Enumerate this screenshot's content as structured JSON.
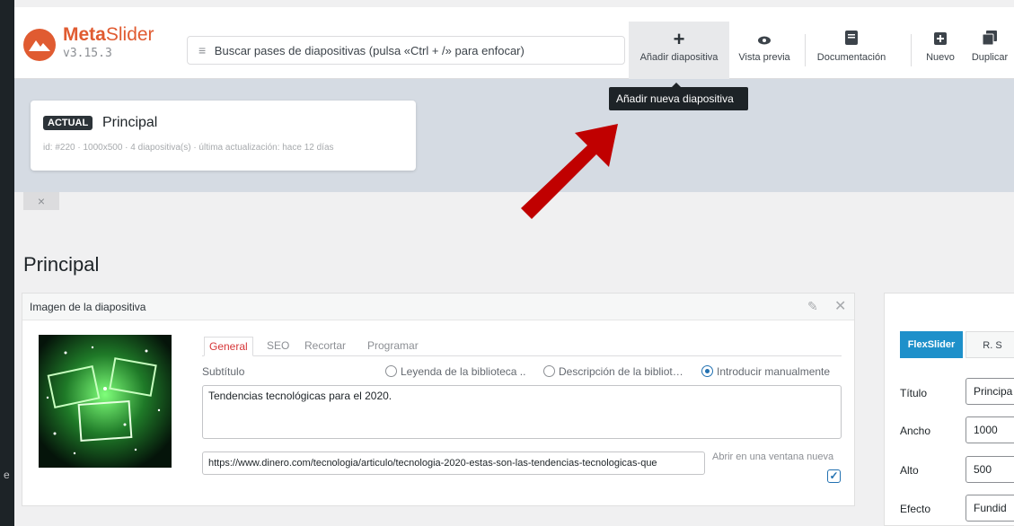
{
  "app": {
    "brand_meta": "Meta",
    "brand_slider": "Slider",
    "version": "v3.15.3",
    "accent": "#e05b31"
  },
  "search": {
    "icon": "hamburger-icon",
    "placeholder": "Buscar pases de diapositivas (pulsa «Ctrl + /» para enfocar)"
  },
  "toolbar": {
    "add_slide": "Añadir diapositiva",
    "preview": "Vista previa",
    "docs": "Documentación",
    "new": "Nuevo",
    "duplicate": "Duplicar"
  },
  "tooltip": "Añadir nueva diapositiva",
  "current_card": {
    "badge": "ACTUAL",
    "title": "Principal",
    "meta": "id: #220 · 1000x500 · 4 diapositiva(s) · última actualización: hace 12 días"
  },
  "page_title": "Principal",
  "slide": {
    "header": "Imagen de la diapositiva",
    "tabs": [
      "General",
      "SEO",
      "Recortar",
      "Programar"
    ],
    "subtitle_label": "Subtítulo",
    "radio_options": [
      "Leyenda de la biblioteca ..",
      "Descripción de la bibliot…",
      "Introducir manualmente"
    ],
    "radio_selected": "Introducir manualmente",
    "caption": "Tendencias tecnológicas para el 2020.",
    "url": "https://www.dinero.com/tecnologia/articulo/tecnologia-2020-estas-son-las-tendencias-tecnologicas-que",
    "new_window_label": "Abrir en una ventana nueva",
    "new_window_checked": true
  },
  "settings": {
    "tab_active": "FlexSlider",
    "tab_other": "R. S",
    "fields": [
      {
        "label": "Título",
        "value": "Principa"
      },
      {
        "label": "Ancho",
        "value": "1000"
      },
      {
        "label": "Alto",
        "value": "500"
      },
      {
        "label": "Efecto",
        "value": "Fundid"
      }
    ],
    "active_color": "#1e90ca"
  },
  "left_strip_glyph": "e"
}
